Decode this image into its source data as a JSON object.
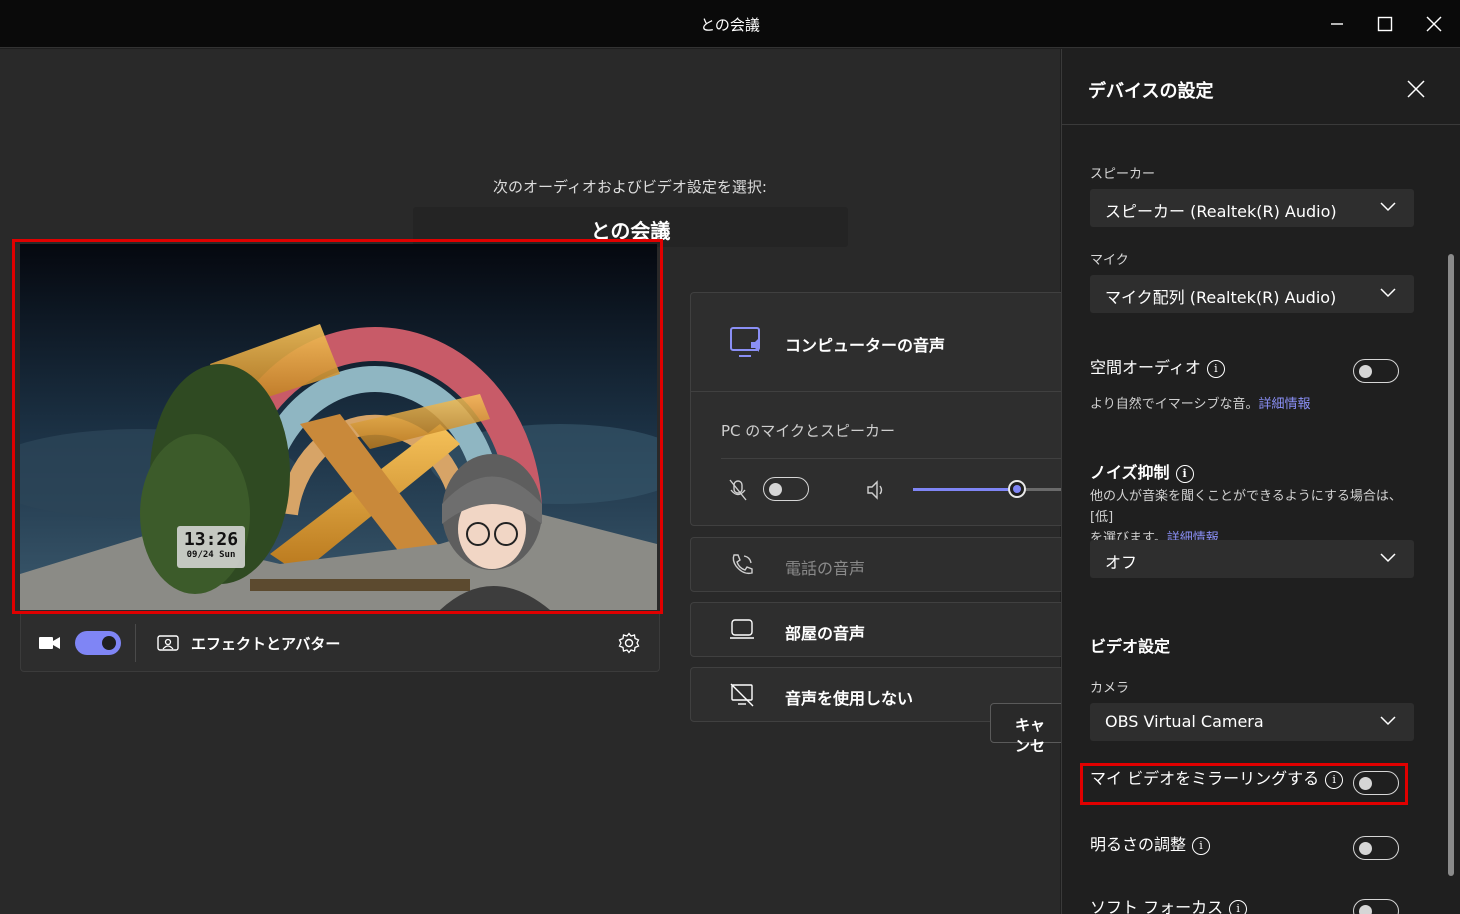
{
  "window": {
    "title": "との会議"
  },
  "prejoin": {
    "subtitle": "次のオーディオおよびビデオ設定を選択:",
    "meeting_name": "との会議",
    "clock_time": "13:26",
    "clock_date": "09/24 Sun",
    "effects_label": "エフェクトとアバター",
    "camera_on": true
  },
  "audio_options": {
    "computer_audio": "コンピューターの音声",
    "pc_mic_speaker": "PC のマイクとスピーカー",
    "mic_enabled": false,
    "speaker_volume_percent": 70,
    "phone_audio": "電話の音声",
    "room_audio": "部屋の音声",
    "no_audio": "音声を使用しない",
    "cancel": "キャンセ"
  },
  "device_settings": {
    "title": "デバイスの設定",
    "speaker_label": "スピーカー",
    "speaker_value": "スピーカー (Realtek(R) Audio)",
    "mic_label": "マイク",
    "mic_value": "マイク配列 (Realtek(R) Audio)",
    "spatial_audio_label": "空間オーディオ",
    "spatial_audio_desc": "より自然でイマーシブな音。",
    "details_link": "詳細情報",
    "noise_label": "ノイズ抑制",
    "noise_desc_1": "他の人が音楽を聞くことができるようにする場合は、[低]",
    "noise_desc_2": "を選びます。",
    "noise_value": "オフ",
    "video_section": "ビデオ設定",
    "camera_label": "カメラ",
    "camera_value": "OBS Virtual Camera",
    "mirror_label": "マイ ビデオをミラーリングする",
    "brightness_label": "明るさの調整",
    "soft_focus_label": "ソフト フォーカス"
  }
}
